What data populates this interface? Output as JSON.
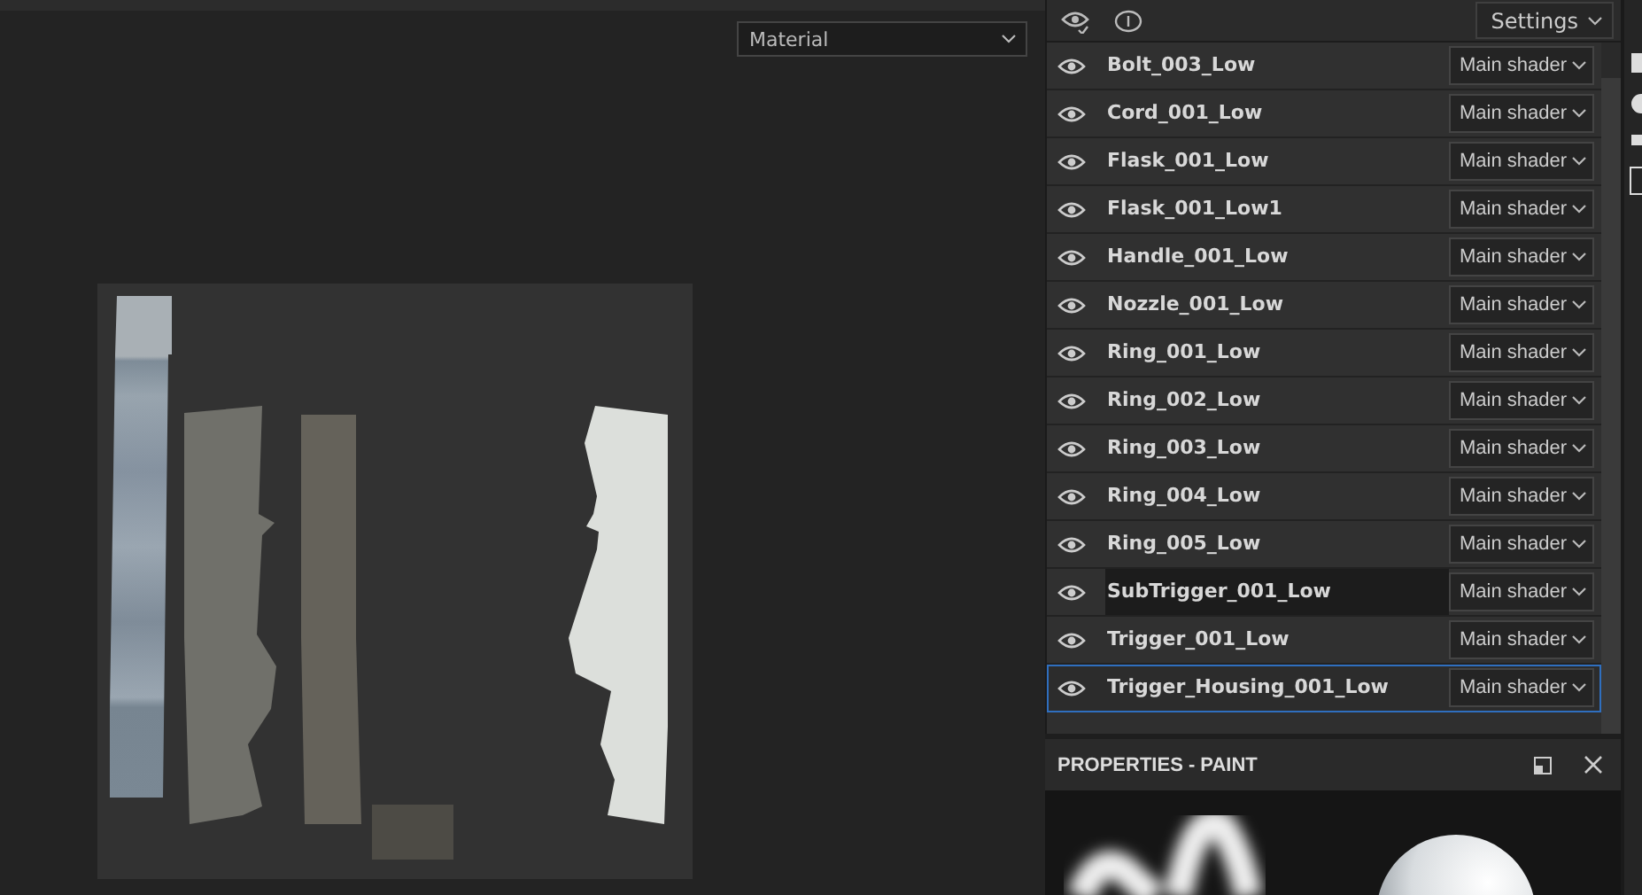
{
  "viewport": {
    "channel_dropdown": "Material"
  },
  "layers_panel": {
    "settings_button": "Settings",
    "layers": [
      {
        "name": "Bolt_003_Low",
        "visible": true,
        "shader": "Main shader",
        "selected": false,
        "highlighted": false
      },
      {
        "name": "Cord_001_Low",
        "visible": true,
        "shader": "Main shader",
        "selected": false,
        "highlighted": false
      },
      {
        "name": "Flask_001_Low",
        "visible": true,
        "shader": "Main shader",
        "selected": false,
        "highlighted": false
      },
      {
        "name": "Flask_001_Low1",
        "visible": true,
        "shader": "Main shader",
        "selected": false,
        "highlighted": false
      },
      {
        "name": "Handle_001_Low",
        "visible": true,
        "shader": "Main shader",
        "selected": false,
        "highlighted": false
      },
      {
        "name": "Nozzle_001_Low",
        "visible": true,
        "shader": "Main shader",
        "selected": false,
        "highlighted": false
      },
      {
        "name": "Ring_001_Low",
        "visible": true,
        "shader": "Main shader",
        "selected": false,
        "highlighted": false
      },
      {
        "name": "Ring_002_Low",
        "visible": true,
        "shader": "Main shader",
        "selected": false,
        "highlighted": false
      },
      {
        "name": "Ring_003_Low",
        "visible": true,
        "shader": "Main shader",
        "selected": false,
        "highlighted": false
      },
      {
        "name": "Ring_004_Low",
        "visible": true,
        "shader": "Main shader",
        "selected": false,
        "highlighted": false
      },
      {
        "name": "Ring_005_Low",
        "visible": true,
        "shader": "Main shader",
        "selected": false,
        "highlighted": false
      },
      {
        "name": "SubTrigger_001_Low",
        "visible": true,
        "shader": "Main shader",
        "selected": false,
        "highlighted": true
      },
      {
        "name": "Trigger_001_Low",
        "visible": true,
        "shader": "Main shader",
        "selected": false,
        "highlighted": false
      },
      {
        "name": "Trigger_Housing_001_Low",
        "visible": true,
        "shader": "Main shader",
        "selected": true,
        "highlighted": false
      }
    ]
  },
  "properties_panel": {
    "title": "PROPERTIES - PAINT"
  }
}
